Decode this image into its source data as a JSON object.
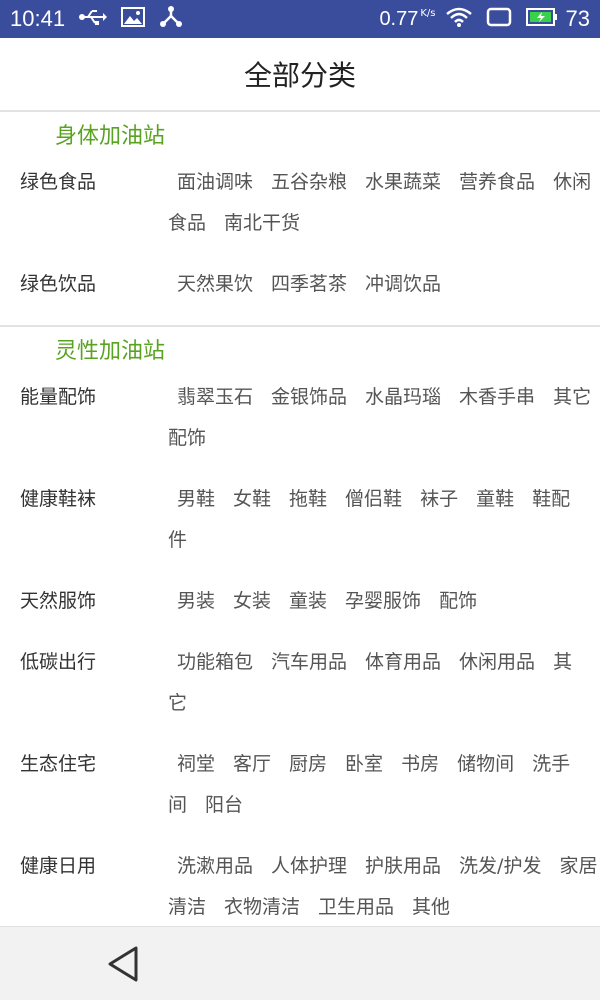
{
  "status_bar": {
    "time": "10:41",
    "speed": "0.77",
    "speed_unit": "K/s",
    "battery": "73",
    "icons": [
      "usb-icon",
      "image-icon",
      "share-icon",
      "wifi-icon",
      "screen-icon",
      "battery-icon"
    ]
  },
  "header": {
    "title": "全部分类"
  },
  "sections": [
    {
      "title": "身体加油站",
      "rows": [
        {
          "label": "绿色食品",
          "tags": [
            "面油调味",
            "五谷杂粮",
            "水果蔬菜",
            "营养食品",
            "休闲食品",
            "南北干货"
          ]
        },
        {
          "label": "绿色饮品",
          "tags": [
            "天然果饮",
            "四季茗茶",
            "冲调饮品"
          ]
        }
      ]
    },
    {
      "title": "灵性加油站",
      "rows": [
        {
          "label": "能量配饰",
          "tags": [
            "翡翠玉石",
            "金银饰品",
            "水晶玛瑙",
            "木香手串",
            "其它配饰"
          ]
        },
        {
          "label": "健康鞋袜",
          "tags": [
            "男鞋",
            "女鞋",
            "拖鞋",
            "僧侣鞋",
            "袜子",
            "童鞋",
            "鞋配件"
          ]
        },
        {
          "label": "天然服饰",
          "tags": [
            "男装",
            "女装",
            "童装",
            "孕婴服饰",
            "配饰"
          ]
        },
        {
          "label": "低碳出行",
          "tags": [
            "功能箱包",
            "汽车用品",
            "体育用品",
            "休闲用品",
            "其它"
          ]
        },
        {
          "label": "生态住宅",
          "tags": [
            "祠堂",
            "客厅",
            "厨房",
            "卧室",
            "书房",
            "储物间",
            "洗手间",
            "阳台"
          ]
        },
        {
          "label": "健康日用",
          "tags": [
            "洗漱用品",
            "人体护理",
            "护肤用品",
            "洗发/护发",
            "家居清洁",
            "衣物清洁",
            "卫生用品",
            "其他"
          ]
        }
      ]
    }
  ],
  "colors": {
    "status_bar": "#3a4c9c",
    "section_title": "#5aa321",
    "nav_bar": "#f2f2f2"
  }
}
